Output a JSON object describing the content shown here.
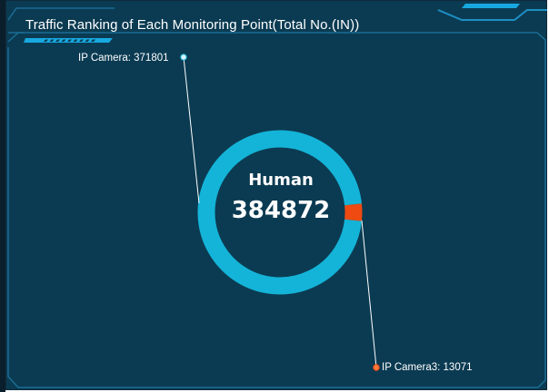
{
  "panel": {
    "title": "Traffic Ranking of Each Monitoring Point(Total No.(IN))"
  },
  "donut": {
    "center_label": "Human",
    "total": "384872"
  },
  "chart_data": {
    "type": "pie",
    "title": "Traffic Ranking of Each Monitoring Point(Total No.(IN))",
    "center_label": "Human",
    "total": 384872,
    "slices": [
      {
        "name": "IP Camera",
        "value": 371801,
        "color": "#14b4d8"
      },
      {
        "name": "IP Camera3",
        "value": 13071,
        "color": "#ee4a12"
      }
    ],
    "callouts": [
      {
        "text": "IP Camera: 371801",
        "dot_color": "#d8f2ff"
      },
      {
        "text": "IP Camera3: 13071",
        "dot_color": "#ff7a3a"
      }
    ]
  },
  "colors": {
    "panel_bg": "#0b3b52",
    "frame": "#1a6d94",
    "accent": "#18a8e0",
    "ring_main": "#14b4d8",
    "ring_minor": "#ee4a12"
  }
}
